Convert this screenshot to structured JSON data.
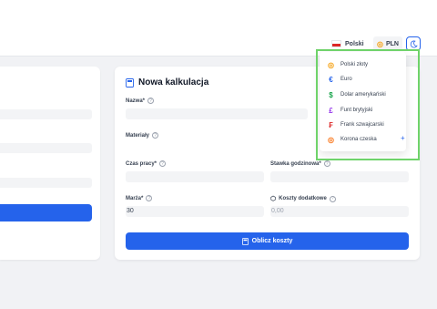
{
  "header": {
    "language_label": "Polski",
    "currency_label": "PLN"
  },
  "currency_dropdown": {
    "items": [
      {
        "label": "Polski złoty",
        "icon": "coins-icon",
        "color": "#f59e0b"
      },
      {
        "label": "Euro",
        "icon": "euro-icon",
        "color": "#2563eb"
      },
      {
        "label": "Dolar amerykański",
        "icon": "dollar-icon",
        "color": "#16a34a"
      },
      {
        "label": "Funt brytyjski",
        "icon": "pound-icon",
        "color": "#9333ea"
      },
      {
        "label": "Frank szwajcarski",
        "icon": "franc-icon",
        "color": "#dc2626"
      },
      {
        "label": "Korona czeska",
        "icon": "coins-icon",
        "color": "#f97316"
      }
    ]
  },
  "form": {
    "title": "Nowa kalkulacja",
    "name_label": "Nazwa*",
    "materials_label": "Materiały",
    "work_time_label": "Czas pracy*",
    "hourly_rate_label": "Stawka godzinowa*",
    "margin_label": "Marża*",
    "margin_value": "30",
    "extra_costs_label": "Koszty dodatkowe",
    "extra_costs_placeholder": "0,00",
    "calculate_button": "Oblicz koszty"
  },
  "colors": {
    "accent": "#2563eb",
    "highlight": "#6fd36a"
  }
}
